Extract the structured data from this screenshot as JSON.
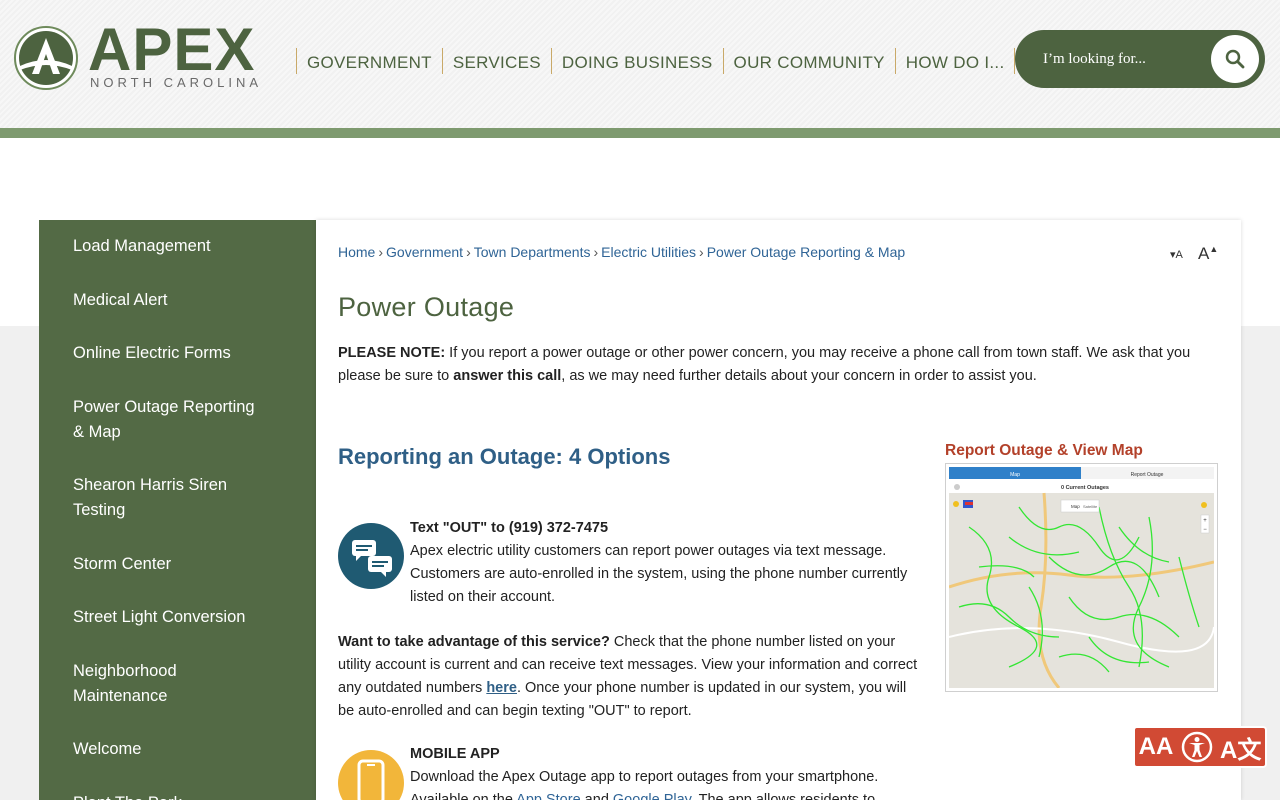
{
  "logo": {
    "word": "APEX",
    "sub": "NORTH CAROLINA"
  },
  "nav": [
    "GOVERNMENT",
    "SERVICES",
    "DOING BUSINESS",
    "OUR COMMUNITY",
    "HOW DO I..."
  ],
  "search": {
    "placeholder": "I’m looking for..."
  },
  "sidebar": {
    "items": [
      {
        "line1": "Load Management",
        "line2": ""
      },
      {
        "line1": "Medical Alert",
        "line2": ""
      },
      {
        "line1": "Online Electric Forms",
        "line2": ""
      },
      {
        "line1": "Power Outage Reporting",
        "line2": "& Map"
      },
      {
        "line1": "Shearon Harris Siren",
        "line2": "Testing"
      },
      {
        "line1": "Storm Center",
        "line2": ""
      },
      {
        "line1": "Street Light Conversion",
        "line2": ""
      },
      {
        "line1": "Neighborhood",
        "line2": "Maintenance"
      },
      {
        "line1": "Welcome",
        "line2": ""
      },
      {
        "line1": "Plant The Park",
        "line2": ""
      }
    ]
  },
  "breadcrumb": [
    "Home",
    "Government",
    "Town Departments",
    "Electric Utilities",
    "Power Outage Reporting & Map"
  ],
  "font_size": {
    "small": "A",
    "large": "A"
  },
  "page_title": "Power Outage",
  "note": {
    "label": "PLEASE NOTE:",
    "text1": " If you report a power outage or other power concern, you may receive a phone call from town staff. We ask that you please be sure to ",
    "bold": "answer this call",
    "text2": ", as we may need further details about your concern in order to assist you."
  },
  "section_title": "Reporting an Outage: 4 Options",
  "text_option": {
    "heading": "Text \"OUT\" to (919) 372-7475",
    "body": "Apex electric utility customers can report power outages via text message. Customers are auto-enrolled in the system, using the phone number currently listed on their account."
  },
  "advantage": {
    "bold": "Want to take advantage of this service?",
    "text1": " Check that the phone number listed on your utility account is current and can receive text messages. View your information and correct any outdated numbers ",
    "link": "here",
    "text2": ". Once your phone number is updated in our system, you will be auto-enrolled and can begin texting \"OUT\" to report."
  },
  "app_option": {
    "heading": "MOBILE APP",
    "line1": "Download the Apex Outage app to report outages from your smartphone.",
    "line2_pre": "Available on the ",
    "app_store": "App Store",
    "and": " and ",
    "google_play": "Google Play",
    "line2_post": ". The app allows residents to"
  },
  "map": {
    "title": "Report Outage & View Map",
    "tab_map": "Map",
    "tab_report": "Report Outage",
    "outages": "0 Current Outages",
    "btn_map": "Map",
    "btn_sat": "Satellite"
  },
  "a11y": {
    "label1": "AA",
    "label3": "A文"
  },
  "colors": {
    "green": "#4d6340",
    "sidebar": "#536a45",
    "link": "#2f6496",
    "accent_red": "#b3412a"
  }
}
